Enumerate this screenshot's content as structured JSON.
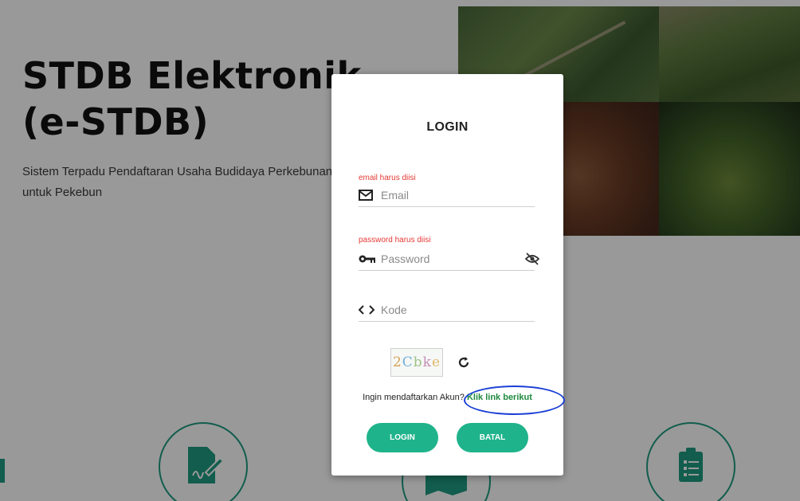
{
  "hero": {
    "title_line1": "STDB Elektronik",
    "title_line2": "(e-STDB)",
    "subtitle": "Sistem Terpadu Pendaftaran Usaha Budidaya Perkebunan untuk Pekebun"
  },
  "login_modal": {
    "title": "LOGIN",
    "email": {
      "error": "email harus diisi",
      "placeholder": "Email",
      "value": ""
    },
    "password": {
      "error": "password harus diisi",
      "placeholder": "Password",
      "value": ""
    },
    "code": {
      "placeholder": "Kode",
      "value": ""
    },
    "captcha_text": [
      "2",
      "C",
      "b",
      "k",
      "e"
    ],
    "register_prompt": "Ingin mendaftarkan Akun",
    "register_question_mark": "?",
    "register_link": "Klik link berikut",
    "login_button": "LOGIN",
    "cancel_button": "BATAL"
  },
  "colors": {
    "accent": "#1fb38b",
    "error": "#e53935",
    "link": "#1f8a3f",
    "highlight": "#1a3fd6"
  },
  "icons": [
    "mail-icon",
    "key-icon",
    "eye-off-icon",
    "code-icon",
    "refresh-icon",
    "signature-doc-icon",
    "map-icon",
    "clipboard-icon"
  ]
}
